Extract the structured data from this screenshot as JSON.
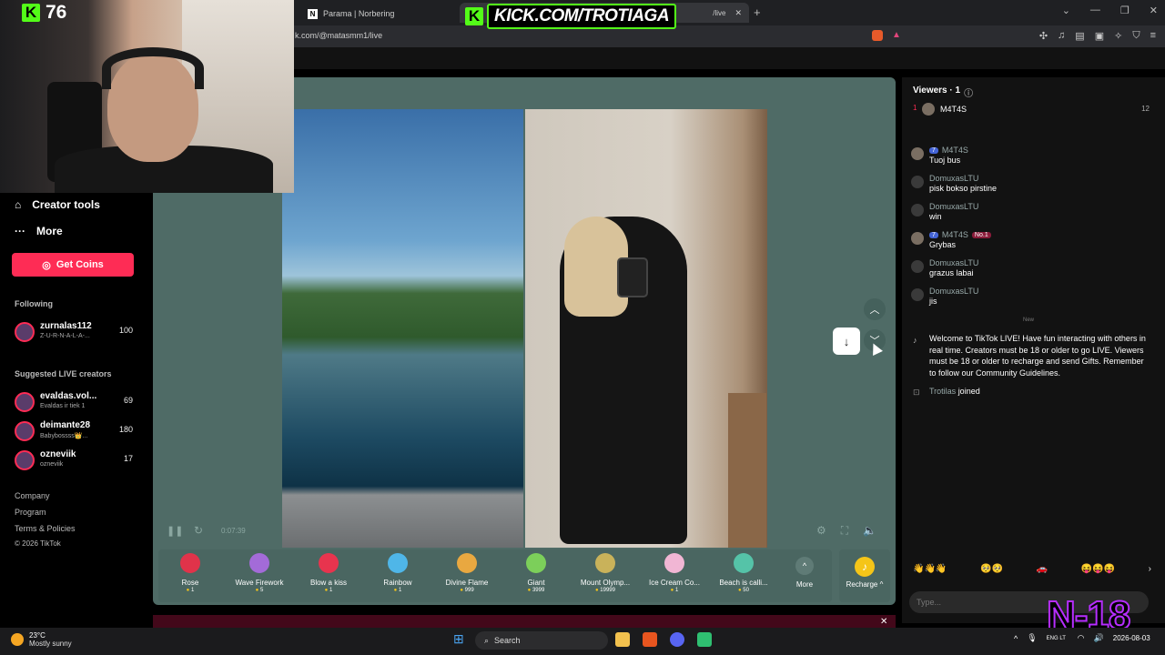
{
  "browser": {
    "tab_other_label": "Parama | Norbering",
    "tab_close": "✕",
    "new_tab": "+",
    "url": "k.com/@matasmm1/live",
    "window_controls": [
      "⌄",
      "—",
      "❐",
      "✕"
    ]
  },
  "overlay": {
    "kick_count": "76",
    "kick_letter": "K",
    "kick_url": "KICK.COM/TROTIAGA",
    "corner_badge": "N-18"
  },
  "sidebar": {
    "creator_tools": "Creator tools",
    "more": "More",
    "get_coins": "Get Coins",
    "following_label": "Following",
    "following": [
      {
        "name": "zurnalas112",
        "sub": "Z-U-R-N-A-L-A-...",
        "count": "100"
      }
    ],
    "suggested_label": "Suggested LIVE creators",
    "suggested": [
      {
        "name": "evaldas.vol...",
        "sub": "Evaldas ir tiek 1",
        "count": "69"
      },
      {
        "name": "deimante28",
        "sub": "Babybossss👑...",
        "count": "180"
      },
      {
        "name": "ozneviik",
        "sub": "ozneviik",
        "count": "17"
      }
    ],
    "footer": [
      "Company",
      "Program",
      "Terms & Policies",
      "© 2026 TikTok"
    ]
  },
  "player": {
    "time": "0:07:39",
    "gifts": [
      {
        "name": "Rose",
        "price": "1",
        "color": "#e0334a"
      },
      {
        "name": "Wave Firework",
        "price": "5",
        "color": "#a36bd8"
      },
      {
        "name": "Blow a kiss",
        "price": "1",
        "color": "#e8344e"
      },
      {
        "name": "Rainbow",
        "price": "1",
        "color": "#4fb6e8"
      },
      {
        "name": "Divine Flame",
        "price": "999",
        "color": "#e9a840"
      },
      {
        "name": "Giant",
        "price": "3999",
        "color": "#7ccf5a"
      },
      {
        "name": "Mount Olymp...",
        "price": "19999",
        "color": "#c9b25a"
      },
      {
        "name": "Ice Cream Co...",
        "price": "1",
        "color": "#f1b6d4"
      },
      {
        "name": "Beach is calli...",
        "price": "50",
        "color": "#55c3a8"
      }
    ],
    "gifts_more": "More",
    "recharge": "Recharge ^"
  },
  "chat": {
    "viewers_label": "Viewers · 1",
    "top_viewer": {
      "rank": "1",
      "name": "M4T4S",
      "score": "12"
    },
    "messages": [
      {
        "user": "M4T4S",
        "badge": "7",
        "badge2": "",
        "text": "Tuoj bus"
      },
      {
        "user": "DomuxasLTU",
        "badge": "",
        "badge2": "",
        "text": "pisk bokso pirstine"
      },
      {
        "user": "DomuxasLTU",
        "badge": "",
        "badge2": "",
        "text": "win"
      },
      {
        "user": "M4T4S",
        "badge": "7",
        "badge2": "No.1",
        "text": "Grybas"
      },
      {
        "user": "DomuxasLTU",
        "badge": "",
        "badge2": "",
        "text": "grazus labai"
      },
      {
        "user": "DomuxasLTU",
        "badge": "",
        "badge2": "",
        "text": "jis"
      }
    ],
    "new_label": "New",
    "welcome": "Welcome to TikTok LIVE! Have fun interacting with others in real time. Creators must be 18 or older to go LIVE. Viewers must be 18 or older to recharge and send Gifts. Remember to follow our Community Guidelines.",
    "joined_user": "Trotilas",
    "joined_text": "joined",
    "emojis": [
      "👋👋👋",
      "🥺🥺",
      "🚗",
      "😝😝😝",
      "›"
    ],
    "input_placeholder": "Type..."
  },
  "taskbar": {
    "temp": "23°C",
    "weather": "Mostly sunny",
    "search": "Search",
    "lang": "ENG LT",
    "date": "2026-08-03"
  }
}
